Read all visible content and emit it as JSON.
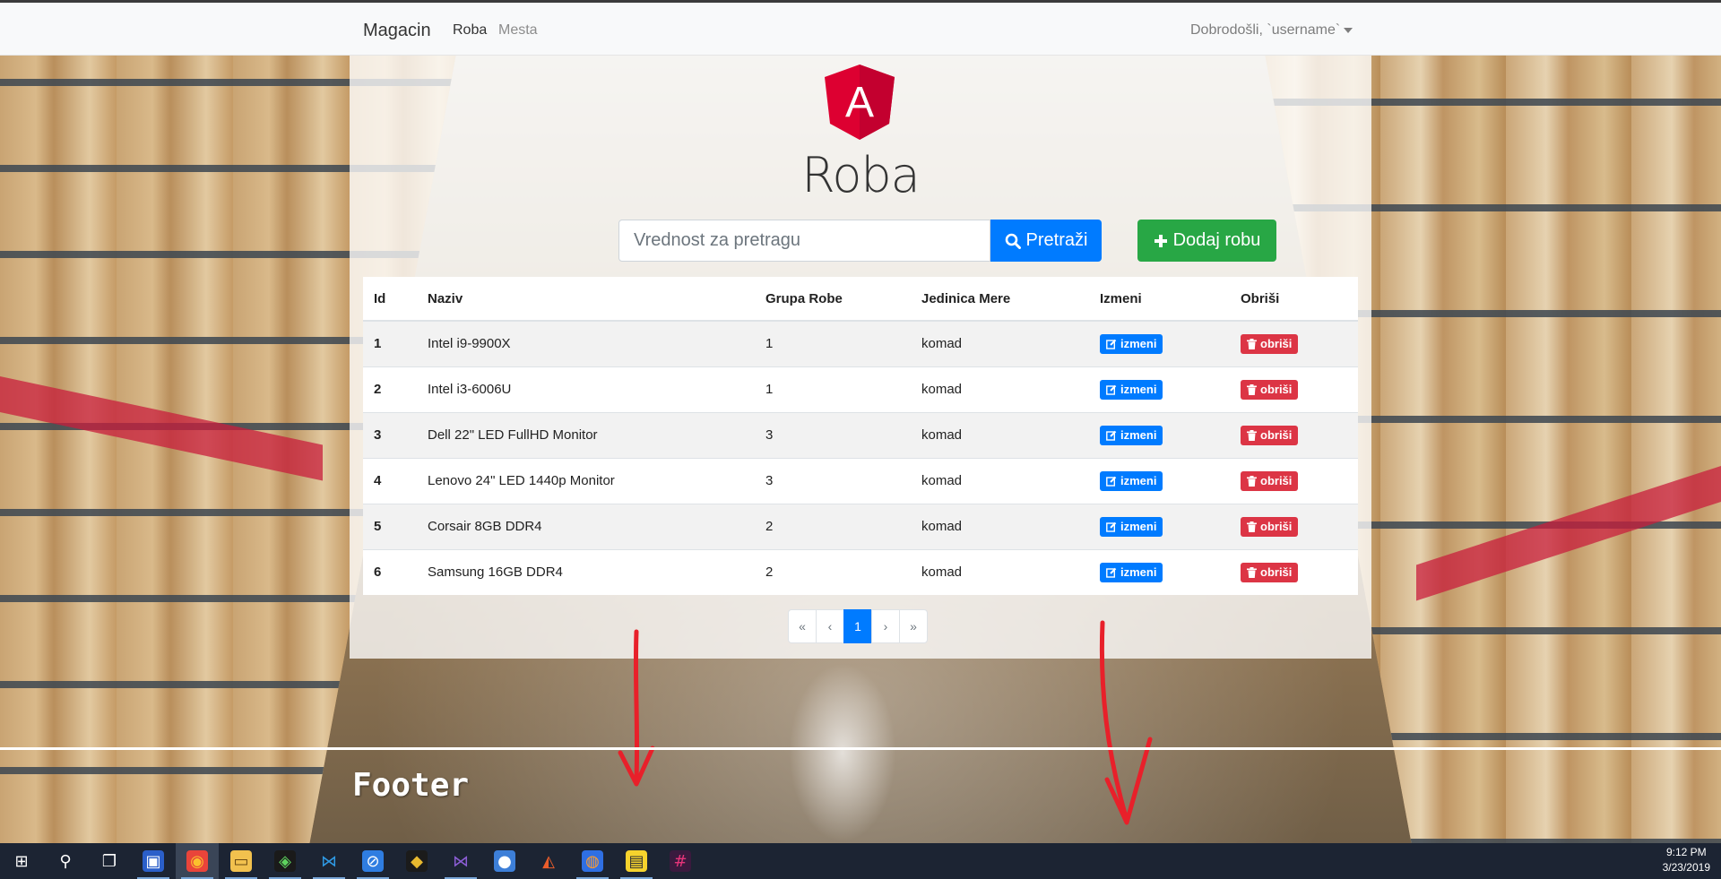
{
  "navbar": {
    "brand": "Magacin",
    "links": [
      {
        "label": "Roba",
        "active": true
      },
      {
        "label": "Mesta",
        "active": false
      }
    ],
    "user_greeting": "Dobrodošli, `username`"
  },
  "page": {
    "logo_letter": "A",
    "title": "Roba",
    "search": {
      "placeholder": "Vrednost za pretragu",
      "value": ""
    },
    "search_button": "Pretraži",
    "add_button": "Dodaj robu"
  },
  "table": {
    "headers": [
      "Id",
      "Naziv",
      "Grupa Robe",
      "Jedinica Mere",
      "Izmeni",
      "Obriši"
    ],
    "edit_label": "izmeni",
    "delete_label": "obriši",
    "rows": [
      {
        "id": "1",
        "naziv": "Intel i9-9900X",
        "grupa": "1",
        "jedinica": "komad"
      },
      {
        "id": "2",
        "naziv": "Intel i3-6006U",
        "grupa": "1",
        "jedinica": "komad"
      },
      {
        "id": "3",
        "naziv": "Dell 22\" LED FullHD Monitor",
        "grupa": "3",
        "jedinica": "komad"
      },
      {
        "id": "4",
        "naziv": "Lenovo 24\" LED 1440p Monitor",
        "grupa": "3",
        "jedinica": "komad"
      },
      {
        "id": "5",
        "naziv": "Corsair 8GB DDR4",
        "grupa": "2",
        "jedinica": "komad"
      },
      {
        "id": "6",
        "naziv": "Samsung 16GB DDR4",
        "grupa": "2",
        "jedinica": "komad"
      }
    ]
  },
  "pagination": {
    "first": "«",
    "prev": "‹",
    "current": "1",
    "next": "›",
    "last": "»"
  },
  "annotation": {
    "footer_label": "Footer",
    "color": "#e8202a"
  },
  "taskbar": {
    "icons": [
      "windows-start-icon",
      "search-icon",
      "task-view-icon",
      "save-app-icon",
      "chrome-icon",
      "file-explorer-icon",
      "git-client-icon",
      "vscode-icon",
      "safari-compass-icon",
      "sourcetree-icon",
      "visual-studio-icon",
      "qbittorrent-icon",
      "office-icon",
      "firefox-icon",
      "sticky-notes-icon",
      "slack-icon"
    ],
    "time": "9:12 PM",
    "date": "3/23/2019"
  },
  "colors": {
    "primary": "#007bff",
    "success": "#28a745",
    "danger": "#dc3545",
    "angular_red": "#dd0031"
  }
}
